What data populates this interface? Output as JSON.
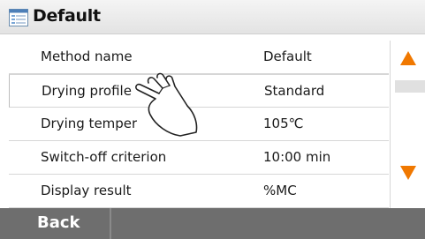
{
  "window": {
    "title": "Default",
    "icon": "list-icon"
  },
  "rows": [
    {
      "label": "Method name",
      "value": "Default"
    },
    {
      "label": "Drying profile",
      "value": "Standard"
    },
    {
      "label": "Drying temper",
      "value": "105℃"
    },
    {
      "label": "Switch-off criterion",
      "value": "10:00 min"
    },
    {
      "label": "Display result",
      "value": "%MC"
    }
  ],
  "scrollbar": {
    "up_icon": "arrow-up-icon",
    "down_icon": "arrow-down-icon",
    "arrow_color": "#f07800"
  },
  "footer": {
    "back_label": "Back"
  },
  "overlay": {
    "icon": "pointing-hand-icon"
  }
}
